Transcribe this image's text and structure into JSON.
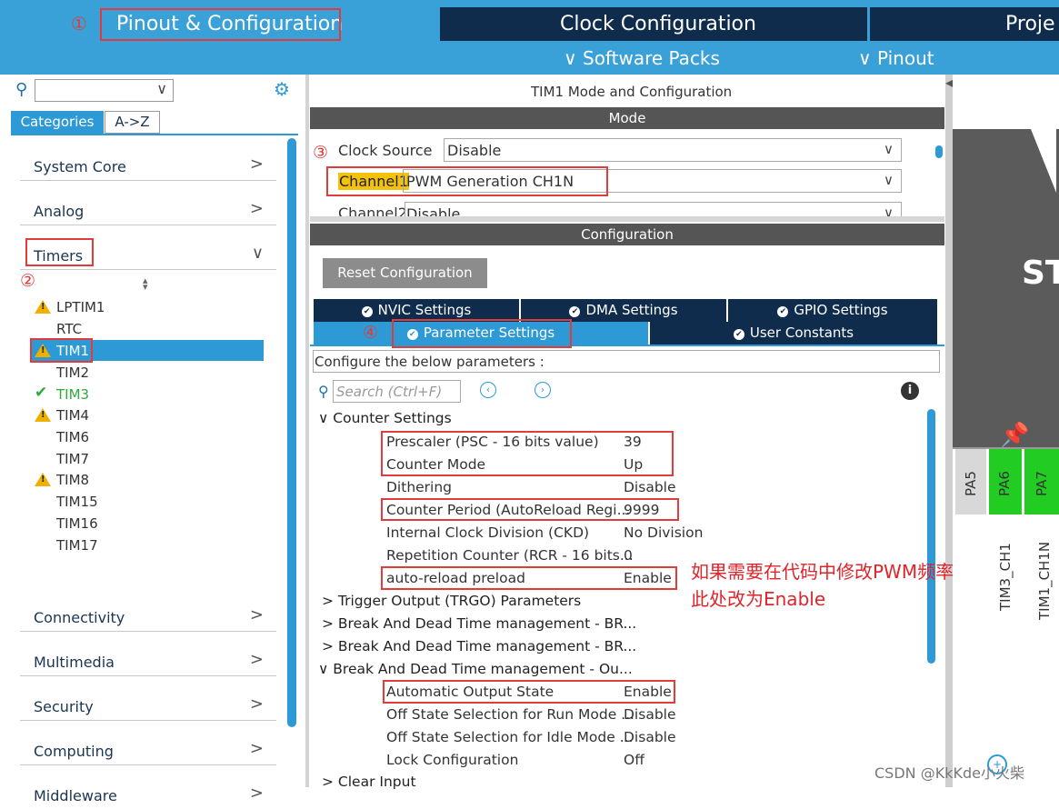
{
  "top_tabs": {
    "pinout_config": "Pinout & Configuration",
    "clock_config": "Clock Configuration",
    "project": "Proje",
    "software_packs": "Software Packs",
    "pinout": "Pinout"
  },
  "markers": {
    "m1": "①",
    "m2": "②",
    "m3": "③",
    "m4": "④"
  },
  "sidebar": {
    "tabs": [
      "Categories",
      "A->Z"
    ],
    "categories": [
      {
        "label": "System Core"
      },
      {
        "label": "Analog"
      },
      {
        "label": "Timers"
      },
      {
        "label": "Connectivity"
      },
      {
        "label": "Multimedia"
      },
      {
        "label": "Security"
      },
      {
        "label": "Computing"
      },
      {
        "label": "Middleware"
      }
    ],
    "timers": [
      {
        "label": "LPTIM1",
        "status": "warning"
      },
      {
        "label": "RTC",
        "status": "none"
      },
      {
        "label": "TIM1",
        "status": "warning"
      },
      {
        "label": "TIM2",
        "status": "none"
      },
      {
        "label": "TIM3",
        "status": "ok"
      },
      {
        "label": "TIM4",
        "status": "warning"
      },
      {
        "label": "TIM6",
        "status": "none"
      },
      {
        "label": "TIM7",
        "status": "none"
      },
      {
        "label": "TIM8",
        "status": "warning"
      },
      {
        "label": "TIM15",
        "status": "none"
      },
      {
        "label": "TIM16",
        "status": "none"
      },
      {
        "label": "TIM17",
        "status": "none"
      }
    ]
  },
  "mode_panel": {
    "title": "TIM1 Mode and Configuration",
    "mode_header": "Mode",
    "clock_source_label": "Clock Source",
    "clock_source_value": "Disable",
    "channel1_label": "Channel1",
    "channel1_value": "PWM Generation CH1N",
    "channel2_label": "Channel2",
    "channel2_value": "Disable"
  },
  "config_panel": {
    "header": "Configuration",
    "reset_button": "Reset Configuration",
    "tabs_row1": [
      "NVIC Settings",
      "DMA Settings",
      "GPIO Settings"
    ],
    "tabs_row2": [
      "Parameter Settings",
      "User Constants"
    ],
    "description": "Configure the below parameters :",
    "search_placeholder": "Search (Ctrl+F)"
  },
  "params": {
    "counter_settings": "Counter Settings",
    "rows": [
      {
        "name": "Prescaler (PSC - 16 bits value)",
        "value": "39"
      },
      {
        "name": "Counter Mode",
        "value": "Up"
      },
      {
        "name": "Dithering",
        "value": "Disable"
      },
      {
        "name": "Counter Period (AutoReload Regi...",
        "value": "9999"
      },
      {
        "name": "Internal Clock Division (CKD)",
        "value": "No Division"
      },
      {
        "name": "Repetition Counter (RCR - 16 bits...",
        "value": "0"
      },
      {
        "name": "auto-reload preload",
        "value": "Enable"
      }
    ],
    "trgo": "Trigger Output (TRGO) Parameters",
    "break1": "Break And Dead Time management - BR...",
    "break2": "Break And Dead Time management - BR...",
    "break_out": "Break And Dead Time management - Ou...",
    "out_rows": [
      {
        "name": "Automatic Output State",
        "value": "Enable"
      },
      {
        "name": "Off State Selection for Run Mode ...",
        "value": "Disable"
      },
      {
        "name": "Off State Selection for Idle Mode ...",
        "value": "Disable"
      },
      {
        "name": "Lock Configuration",
        "value": "Off"
      }
    ],
    "clear_input": "Clear Input"
  },
  "annotation": {
    "line1": "如果需要在代码中修改PWM频率",
    "line2": "此处改为Enable"
  },
  "chip": {
    "label": "ST",
    "pins": [
      "PA5",
      "PA6",
      "PA7"
    ],
    "pin_labels": [
      "TIM3_CH1",
      "TIM1_CH1N"
    ]
  },
  "watermark": "CSDN @KkKde小火柴",
  "colors": {
    "topbar": "#3aa0d8",
    "dark_navy": "#0f2c4d",
    "selected": "#2d9ad6",
    "pin_green": "#22cc22",
    "annotation_red": "#e0242a"
  }
}
